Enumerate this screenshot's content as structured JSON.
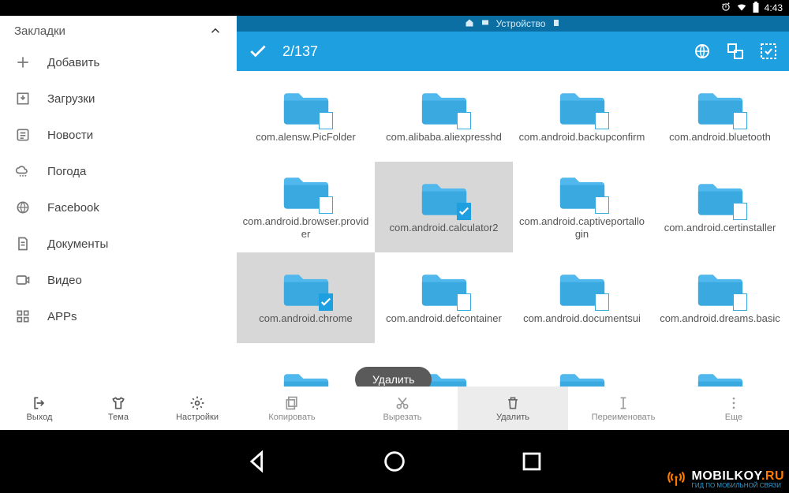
{
  "statusbar": {
    "time": "4:43"
  },
  "breadcrumb": {
    "label": "Устройство"
  },
  "toolbar": {
    "selection": "2/137"
  },
  "sidebar": {
    "section_title": "Закладки",
    "items": [
      {
        "label": "Добавить"
      },
      {
        "label": "Загрузки"
      },
      {
        "label": "Новости"
      },
      {
        "label": "Погода"
      },
      {
        "label": "Facebook"
      },
      {
        "label": "Документы"
      },
      {
        "label": "Видео"
      },
      {
        "label": "APPs"
      }
    ],
    "bottom": [
      {
        "label": "Выход"
      },
      {
        "label": "Тема"
      },
      {
        "label": "Настройки"
      }
    ]
  },
  "actions": [
    {
      "label": "Копировать"
    },
    {
      "label": "Вырезать"
    },
    {
      "label": "Удалить"
    },
    {
      "label": "Переименовать"
    },
    {
      "label": "Еще"
    }
  ],
  "toast": {
    "text": "Удалить"
  },
  "folders": [
    {
      "name": "com.alensw.PicFolder",
      "selected": false
    },
    {
      "name": "com.alibaba.aliexpresshd",
      "selected": false
    },
    {
      "name": "com.android.backupconfirm",
      "selected": false
    },
    {
      "name": "com.android.bluetooth",
      "selected": false
    },
    {
      "name": "com.android.browser.provider",
      "selected": false
    },
    {
      "name": "com.android.calculator2",
      "selected": true
    },
    {
      "name": "com.android.captiveportallogin",
      "selected": false
    },
    {
      "name": "com.android.certinstaller",
      "selected": false
    },
    {
      "name": "com.android.chrome",
      "selected": true
    },
    {
      "name": "com.android.defcontainer",
      "selected": false
    },
    {
      "name": "com.android.documentsui",
      "selected": false
    },
    {
      "name": "com.android.dreams.basic",
      "selected": false
    }
  ],
  "watermark": {
    "brand_a": "MOBILKOY",
    "brand_b": ".RU",
    "tagline": "ГИД ПО МОБИЛЬНОЙ СВЯЗИ"
  }
}
